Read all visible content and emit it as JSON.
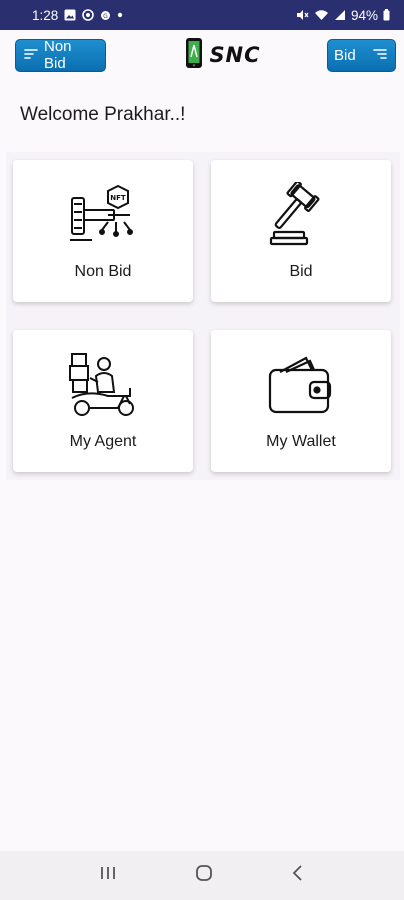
{
  "status_bar": {
    "time": "1:28",
    "battery": "94%",
    "left_icons": [
      "gallery-icon",
      "whatsapp-icon",
      "sync-icon",
      "dot-icon"
    ],
    "right_icons": [
      "mute-icon",
      "wifi-icon",
      "signal-icon",
      "battery-icon"
    ]
  },
  "app_bar": {
    "left_button_label": "Non Bid",
    "right_button_label": "Bid",
    "logo_text": "SNC"
  },
  "welcome_text": "Welcome Prakhar..!",
  "cards": [
    {
      "label": "Non Bid",
      "icon": "nft-auction-icon"
    },
    {
      "label": "Bid",
      "icon": "gavel-icon"
    },
    {
      "label": "My Agent",
      "icon": "delivery-agent-icon"
    },
    {
      "label": "My Wallet",
      "icon": "wallet-icon"
    }
  ],
  "nav_bar": {
    "items": [
      "recents-icon",
      "home-icon",
      "back-icon"
    ]
  },
  "colors": {
    "status_bar_bg": "#2a2f6f",
    "button_blue": "#0a7bc0",
    "page_bg": "#fcf9fd",
    "nav_bg": "#f2eff3"
  }
}
